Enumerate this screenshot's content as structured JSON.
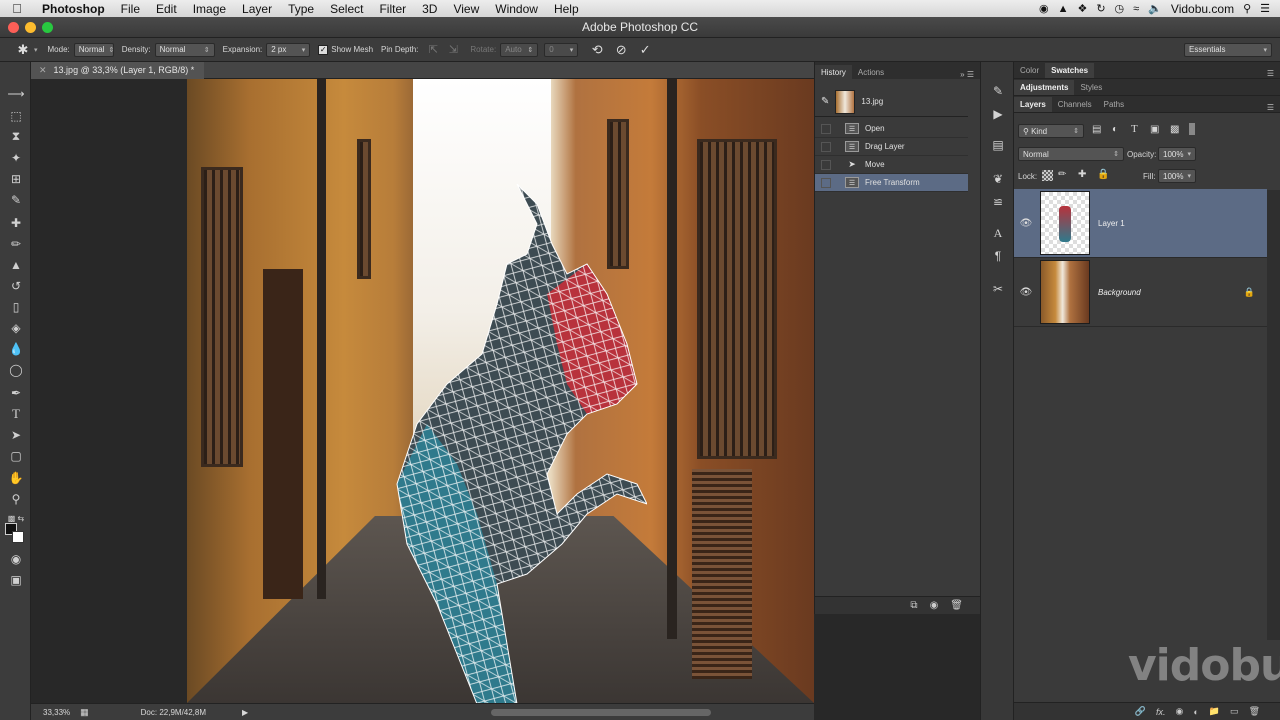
{
  "menubar": {
    "app": "Photoshop",
    "items": [
      "File",
      "Edit",
      "Image",
      "Layer",
      "Type",
      "Select",
      "Filter",
      "3D",
      "View",
      "Window",
      "Help"
    ],
    "right_label": "Vidobu.com"
  },
  "window": {
    "title": "Adobe Photoshop CC"
  },
  "options": {
    "mode_label": "Mode:",
    "mode_value": "Normal",
    "density_label": "Density:",
    "density_value": "Normal",
    "expansion_label": "Expansion:",
    "expansion_value": "2 px",
    "show_mesh_label": "Show Mesh",
    "pin_depth_label": "Pin Depth:",
    "rotate_label": "Rotate:",
    "rotate_value": "Auto",
    "rotate_deg": "0",
    "workspace": "Essentials"
  },
  "document": {
    "tab_title": "13.jpg @ 33,3% (Layer 1, RGB/8) *",
    "zoom": "33,33%",
    "doc_size": "Doc: 22,9M/42,8M"
  },
  "history": {
    "tabs": [
      "History",
      "Actions"
    ],
    "snapshot": "13.jpg",
    "items": [
      "Open",
      "Drag Layer",
      "Move",
      "Free Transform"
    ]
  },
  "right": {
    "tabs_top": [
      "Color",
      "Swatches"
    ],
    "tabs_mid": [
      "Adjustments",
      "Styles"
    ],
    "tabs_layers": [
      "Layers",
      "Channels",
      "Paths"
    ],
    "kind_filter": "Kind",
    "blend_mode": "Normal",
    "opacity_label": "Opacity:",
    "opacity_value": "100%",
    "lock_label": "Lock:",
    "fill_label": "Fill:",
    "fill_value": "100%",
    "layers": [
      "Layer 1",
      "Background"
    ]
  },
  "watermark": "vidobu"
}
